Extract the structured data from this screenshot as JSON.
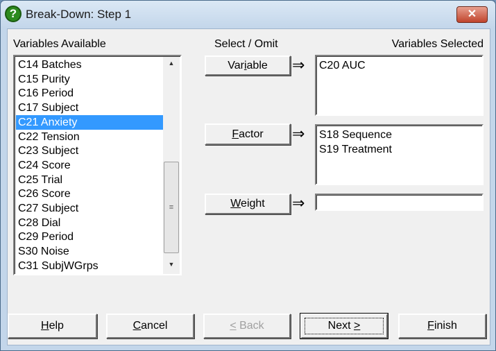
{
  "window": {
    "title": "Break-Down: Step 1",
    "icon": "help-question-icon",
    "close": "✕"
  },
  "labels": {
    "available": "Variables Available",
    "select_omit": "Select / Omit",
    "selected": "Variables Selected"
  },
  "available": {
    "items": [
      "C14 Batches",
      "C15 Purity",
      "C16 Period",
      "C17 Subject",
      "C21 Anxiety",
      "C22 Tension",
      "C23 Subject",
      "C24 Score",
      "C25 Trial",
      "C26 Score",
      "C27 Subject",
      "C28 Dial",
      "C29 Period",
      "S30 Noise",
      "C31 SubjWGrps"
    ],
    "selected_index": 4
  },
  "buttons": {
    "variable": {
      "pre": "Var",
      "key": "i",
      "post": "able"
    },
    "factor": {
      "pre": "",
      "key": "F",
      "post": "actor"
    },
    "weight": {
      "pre": "",
      "key": "W",
      "post": "eight"
    },
    "help": {
      "pre": "",
      "key": "H",
      "post": "elp"
    },
    "cancel": {
      "pre": "",
      "key": "C",
      "post": "ancel"
    },
    "back": {
      "pre": "",
      "key": "<",
      "post": " Back",
      "disabled": true
    },
    "next": {
      "pre": "Next ",
      "key": ">",
      "post": "",
      "default": true
    },
    "finish": {
      "pre": "",
      "key": "F",
      "post": "inish"
    }
  },
  "arrow": "⇒",
  "targets": {
    "variable": [
      "C20 AUC"
    ],
    "factor": [
      "S18 Sequence",
      "S19 Treatment"
    ],
    "weight": []
  },
  "colors": {
    "selection": "#3399ff"
  }
}
